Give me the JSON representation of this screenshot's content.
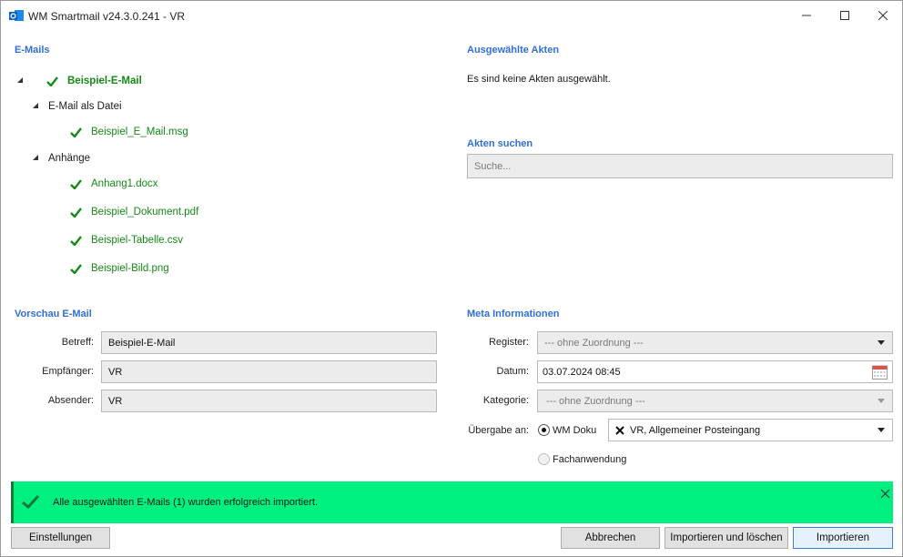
{
  "window": {
    "title": "WM Smartmail v24.3.0.241 - VR"
  },
  "emails": {
    "heading": "E-Mails",
    "root": "Beispiel-E-Mail",
    "group_file": "E-Mail als Datei",
    "file_item": "Beispiel_E_Mail.msg",
    "group_attachments": "Anhänge",
    "attachments": [
      "Anhang1.docx",
      "Beispiel_Dokument.pdf",
      "Beispiel-Tabelle.csv",
      "Beispiel-Bild.png"
    ]
  },
  "selected": {
    "heading": "Ausgewählte Akten",
    "empty_text": "Es sind keine Akten ausgewählt."
  },
  "search": {
    "heading": "Akten suchen",
    "placeholder": "Suche..."
  },
  "preview": {
    "heading": "Vorschau E-Mail",
    "subject_label": "Betreff:",
    "subject_value": "Beispiel-E-Mail",
    "recipient_label": "Empfänger:",
    "recipient_value": "VR",
    "sender_label": "Absender:",
    "sender_value": "VR"
  },
  "meta": {
    "heading": "Meta Informationen",
    "register_label": "Register:",
    "register_value": "--- ohne Zuordnung ---",
    "date_label": "Datum:",
    "date_value": "03.07.2024 08:45",
    "category_label": "Kategorie:",
    "category_value": "--- ohne Zuordnung ---",
    "handover_label": "Übergabe an:",
    "option_doku": "WM Doku",
    "option_fach": "Fachanwendung",
    "doku_target": "VR, Allgemeiner Posteingang"
  },
  "banner": {
    "message": "Alle ausgewählten E-Mails (1) wurden erfolgreich importiert.",
    "color": "#00f07f"
  },
  "buttons": {
    "settings": "Einstellungen",
    "cancel": "Abbrechen",
    "import_delete": "Importieren und löschen",
    "import": "Importieren"
  }
}
